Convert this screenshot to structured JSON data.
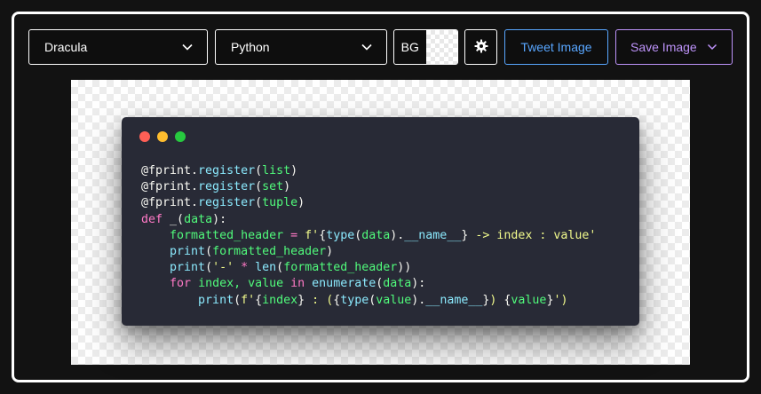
{
  "toolbar": {
    "theme_select": {
      "value": "Dracula"
    },
    "language_select": {
      "value": "Python"
    },
    "background": {
      "label": "BG"
    },
    "settings": {
      "icon": "gear-icon"
    },
    "tweet_button": {
      "label": "Tweet Image"
    },
    "save_button": {
      "label": "Save Image"
    }
  },
  "colors": {
    "accent_tweet": "#58a6ff",
    "accent_save": "#bd93f9",
    "window_bg": "#282a36",
    "dot_close": "#ff5f56",
    "dot_minimize": "#ffbd2e",
    "dot_maximize": "#27c93f"
  },
  "code": {
    "lines": [
      [
        [
          "@fprint.",
          "plain"
        ],
        [
          "register",
          "fn"
        ],
        [
          "(",
          "plain"
        ],
        [
          "list",
          "var"
        ],
        [
          ")",
          "plain"
        ]
      ],
      [
        [
          "@fprint.",
          "plain"
        ],
        [
          "register",
          "fn"
        ],
        [
          "(",
          "plain"
        ],
        [
          "set",
          "var"
        ],
        [
          ")",
          "plain"
        ]
      ],
      [
        [
          "@fprint.",
          "plain"
        ],
        [
          "register",
          "fn"
        ],
        [
          "(",
          "plain"
        ],
        [
          "tuple",
          "var"
        ],
        [
          ")",
          "plain"
        ]
      ],
      [
        [
          "def",
          "kw"
        ],
        [
          " _(",
          "plain"
        ],
        [
          "data",
          "var"
        ],
        [
          "):",
          "plain"
        ]
      ],
      [
        [
          "    ",
          "plain"
        ],
        [
          "formatted_header",
          "var"
        ],
        [
          " = ",
          "kw"
        ],
        [
          "f'",
          "str"
        ],
        [
          "{",
          "plain"
        ],
        [
          "type",
          "fn"
        ],
        [
          "(",
          "plain"
        ],
        [
          "data",
          "var"
        ],
        [
          ").",
          "plain"
        ],
        [
          "__name__",
          "fn"
        ],
        [
          "}",
          "plain"
        ],
        [
          " -> index : value'",
          "str"
        ]
      ],
      [
        [
          "    ",
          "plain"
        ],
        [
          "print",
          "fn"
        ],
        [
          "(",
          "plain"
        ],
        [
          "formatted_header",
          "var"
        ],
        [
          ")",
          "plain"
        ]
      ],
      [
        [
          "    ",
          "plain"
        ],
        [
          "print",
          "fn"
        ],
        [
          "(",
          "plain"
        ],
        [
          "'-'",
          "str"
        ],
        [
          " * ",
          "kw"
        ],
        [
          "len",
          "fn"
        ],
        [
          "(",
          "plain"
        ],
        [
          "formatted_header",
          "var"
        ],
        [
          "))",
          "plain"
        ]
      ],
      [
        [
          "    ",
          "plain"
        ],
        [
          "for",
          "kw"
        ],
        [
          " index, value ",
          "var"
        ],
        [
          "in",
          "kw"
        ],
        [
          " ",
          "plain"
        ],
        [
          "enumerate",
          "fn"
        ],
        [
          "(",
          "plain"
        ],
        [
          "data",
          "var"
        ],
        [
          "):",
          "plain"
        ]
      ],
      [
        [
          "        ",
          "plain"
        ],
        [
          "print",
          "fn"
        ],
        [
          "(",
          "plain"
        ],
        [
          "f'",
          "str"
        ],
        [
          "{",
          "plain"
        ],
        [
          "index",
          "var"
        ],
        [
          "}",
          "plain"
        ],
        [
          " : (",
          "str"
        ],
        [
          "{",
          "plain"
        ],
        [
          "type",
          "fn"
        ],
        [
          "(",
          "plain"
        ],
        [
          "value",
          "var"
        ],
        [
          ").",
          "plain"
        ],
        [
          "__name__",
          "fn"
        ],
        [
          "}",
          "plain"
        ],
        [
          ") ",
          "str"
        ],
        [
          "{",
          "plain"
        ],
        [
          "value",
          "var"
        ],
        [
          "}",
          "plain"
        ],
        [
          "')",
          "str"
        ]
      ]
    ]
  }
}
